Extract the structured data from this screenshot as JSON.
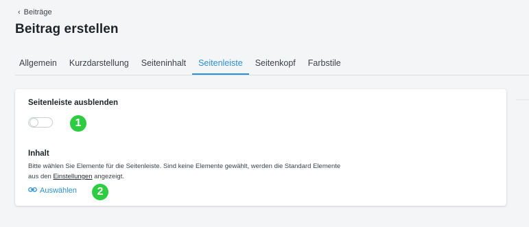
{
  "breadcrumb": {
    "back_label": "Beiträge"
  },
  "page": {
    "title": "Beitrag erstellen"
  },
  "tabs": [
    {
      "label": "Allgemein",
      "active": false
    },
    {
      "label": "Kurzdarstellung",
      "active": false
    },
    {
      "label": "Seiteninhalt",
      "active": false
    },
    {
      "label": "Seitenleiste",
      "active": true
    },
    {
      "label": "Seitenkopf",
      "active": false
    },
    {
      "label": "Farbstile",
      "active": false
    }
  ],
  "card": {
    "hide_sidebar": {
      "title": "Seitenleiste ausblenden",
      "toggle_on": false
    },
    "content": {
      "title": "Inhalt",
      "description_line1": "Bitte wählen Sie Elemente für die Seitenleiste. Sind keine Elemente gewählt, werden die Standard Elemente",
      "description_prefix": "aus den",
      "settings_link": "Einstellungen",
      "description_suffix": "angezeigt.",
      "select_link": "Auswählen",
      "select_icon": "link-icon"
    }
  },
  "annotations": {
    "badge1": "1",
    "badge2": "2",
    "badge_color": "#2ecc40"
  },
  "colors": {
    "accent": "#2a8fd6",
    "background": "#f4f5f7",
    "card": "#ffffff"
  }
}
